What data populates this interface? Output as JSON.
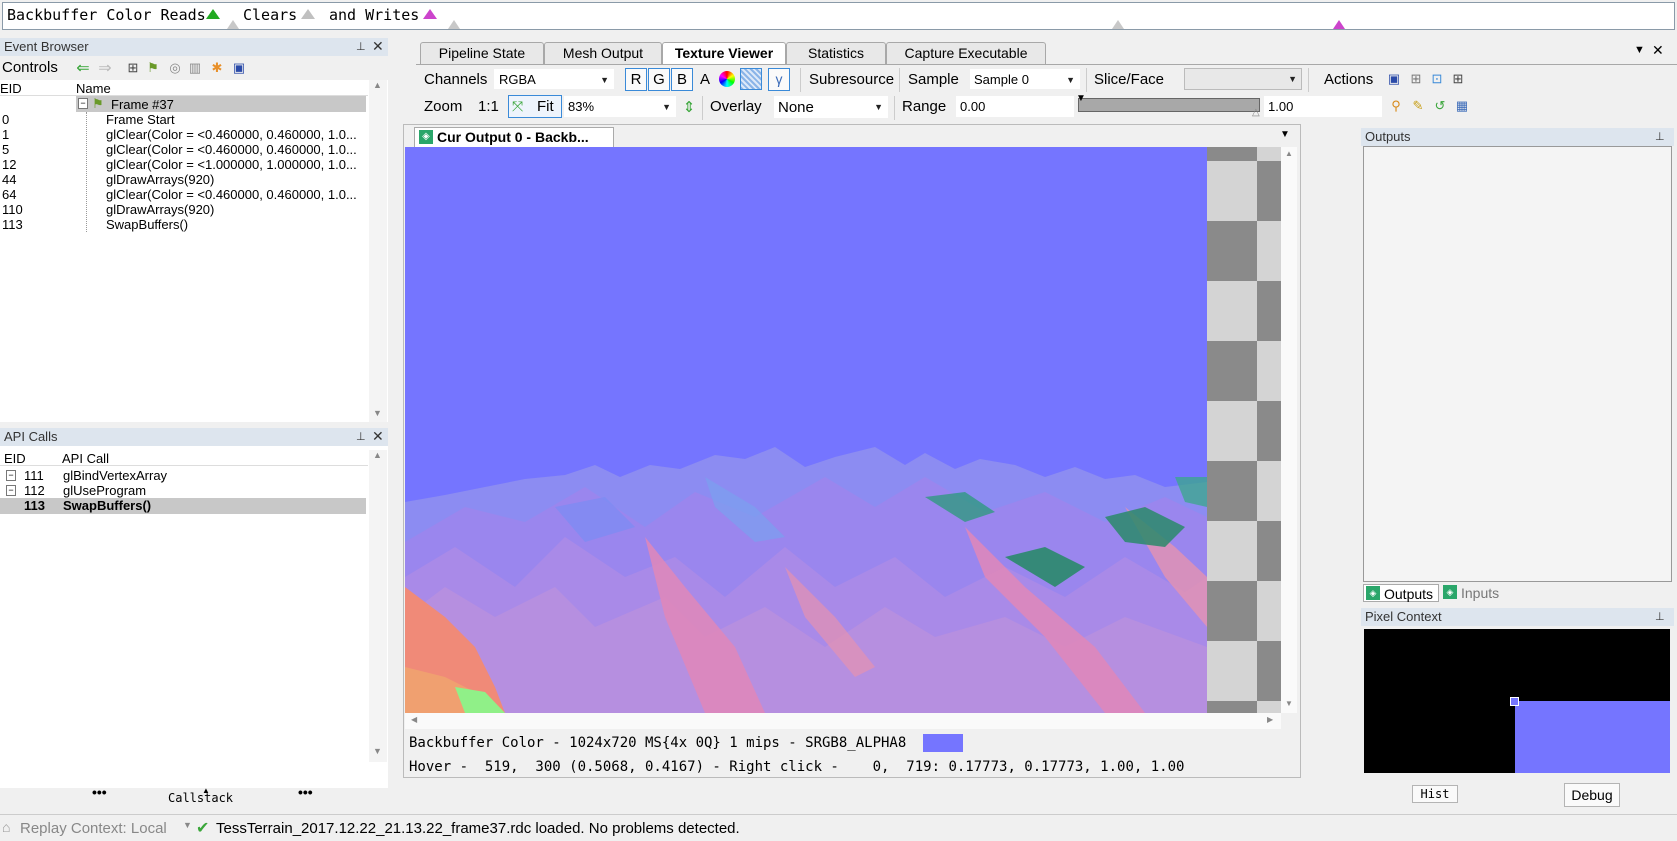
{
  "timeline": {
    "label": "Backbuffer Color Reads",
    "clears": "Clears",
    "writes": "and Writes"
  },
  "event_browser": {
    "title": "Event Browser",
    "controls_label": "Controls",
    "col_eid": "EID",
    "col_name": "Name",
    "frame": "Frame #37",
    "rows": [
      {
        "eid": "0",
        "name": "Frame Start"
      },
      {
        "eid": "1",
        "name": "glClear(Color = <0.460000, 0.460000, 1.0..."
      },
      {
        "eid": "5",
        "name": "glClear(Color = <0.460000, 0.460000, 1.0..."
      },
      {
        "eid": "12",
        "name": "glClear(Color = <1.000000, 1.000000, 1.0..."
      },
      {
        "eid": "44",
        "name": "glDrawArrays(920)"
      },
      {
        "eid": "64",
        "name": "glClear(Color = <0.460000, 0.460000, 1.0..."
      },
      {
        "eid": "110",
        "name": "glDrawArrays(920)"
      },
      {
        "eid": "113",
        "name": "SwapBuffers()"
      }
    ]
  },
  "api_calls": {
    "title": "API Calls",
    "col_eid": "EID",
    "col_call": "API Call",
    "rows": [
      {
        "eid": "111",
        "call": "glBindVertexArray"
      },
      {
        "eid": "112",
        "call": "glUseProgram"
      },
      {
        "eid": "113",
        "call": "SwapBuffers()"
      }
    ],
    "callstack": "Callstack"
  },
  "tabs": [
    "Pipeline State",
    "Mesh Output",
    "Texture Viewer",
    "Statistics",
    "Capture Executable"
  ],
  "texture_toolbar": {
    "channels_label": "Channels",
    "channels_value": "RGBA",
    "r": "R",
    "g": "G",
    "b": "B",
    "a": "A",
    "gamma": "γ",
    "subresource": "Subresource",
    "sample_label": "Sample",
    "sample_value": "Sample 0",
    "slice_label": "Slice/Face",
    "actions_label": "Actions",
    "zoom_label": "Zoom",
    "zoom_1to1": "1:1",
    "fit": "Fit",
    "zoom_value": "83%",
    "overlay_label": "Overlay",
    "overlay_value": "None",
    "range_label": "Range",
    "range_min": "0.00",
    "range_max": "1.00"
  },
  "viewer": {
    "tab_title": "Cur Output 0 - Backb...",
    "info": "Backbuffer Color - 1024x720 MS{4x 0Q} 1 mips - SRGB8_ALPHA8",
    "hover": "Hover -  519,  300 (0.5068, 0.4167) - Right click -    0,  719: 0.17773, 0.17773, 1.00, 1.00",
    "swatch_color": "#7575ff"
  },
  "outputs_panel": {
    "title": "Outputs",
    "tab_outputs": "Outputs",
    "tab_inputs": "Inputs"
  },
  "pixel_context": {
    "title": "Pixel Context",
    "hist": "Hist",
    "debug": "Debug"
  },
  "status": {
    "replay_context": "Replay Context: Local",
    "message": "TessTerrain_2017.12.22_21.13.22_frame37.rdc loaded. No problems detected."
  },
  "colors": {
    "background_blue": "#7575ff",
    "timeline_green": "#22aa22",
    "timeline_magenta": "#cc44cc"
  }
}
